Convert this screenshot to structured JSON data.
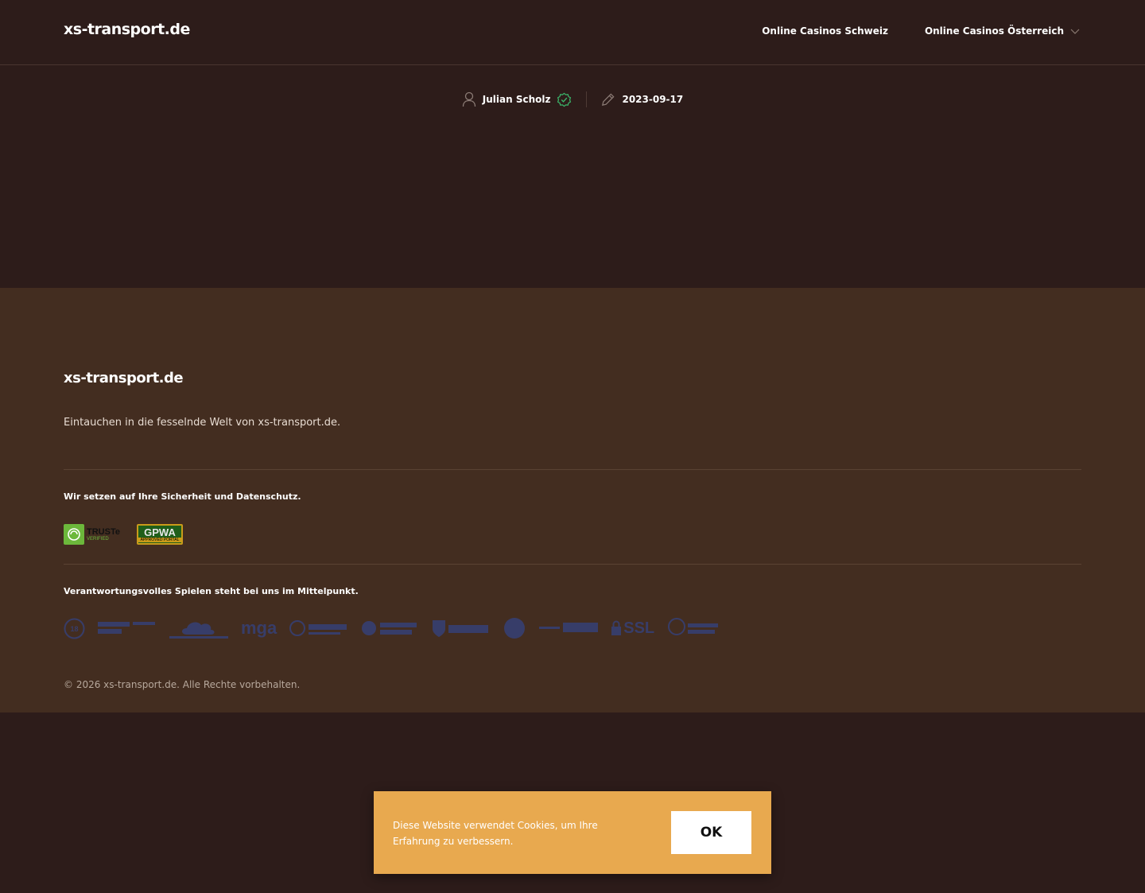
{
  "header": {
    "logo": "xs-transport.de",
    "nav": [
      {
        "label": "Online Casinos Schweiz"
      },
      {
        "label": "Online Casinos Österreich",
        "has_dropdown": true
      }
    ]
  },
  "meta": {
    "author": "Julian Scholz",
    "date": "2023-09-17"
  },
  "footer": {
    "logo": "xs-transport.de",
    "tagline": "Eintauchen in die fesselnde Welt von xs-transport.de.",
    "security_heading": "Wir setzen auf Ihre Sicherheit und Datenschutz.",
    "security_badges": {
      "truste_main": "TRUSTe",
      "truste_sub": "VERIFIED",
      "gpwa_main": "GPWA",
      "gpwa_sub": "APPROVED PORTAL"
    },
    "responsible_heading": "Verantwortungsvolles Spielen steht bei uns im Mittelpunkt.",
    "responsible_logos": {
      "mga": "mga",
      "ssl": "SSL"
    },
    "copyright": "© 2026 xs-transport.de. Alle Rechte vorbehalten."
  },
  "cookie": {
    "text": "Diese Website verwendet Cookies, um Ihre Erfahrung zu verbessern.",
    "button": "OK"
  },
  "colors": {
    "background": "#2d1c1a",
    "footer": "#432d20",
    "cookie": "#e8a94f",
    "verified": "#3bb56a"
  }
}
